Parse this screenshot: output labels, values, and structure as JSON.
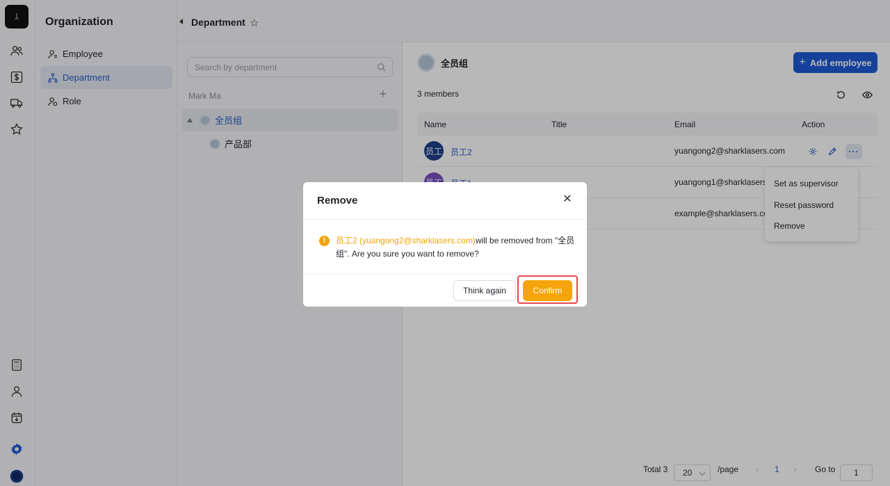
{
  "nav": {
    "title": "Organization",
    "items": [
      {
        "label": "Employee",
        "icon": "user-icon"
      },
      {
        "label": "Department",
        "icon": "org-chart-icon",
        "active": true
      },
      {
        "label": "Role",
        "icon": "role-icon"
      }
    ]
  },
  "header": {
    "title": "Department"
  },
  "tree": {
    "search_placeholder": "Search by department",
    "org_name": "Mark Ma",
    "nodes": [
      {
        "label": "全员组",
        "selected": true
      },
      {
        "label": "产品部"
      }
    ]
  },
  "main": {
    "group_name": "全员组",
    "add_button": "Add employee",
    "member_count": "3 members",
    "columns": [
      "Name",
      "Title",
      "Email",
      "Action"
    ],
    "rows": [
      {
        "avatar": "员工",
        "name": "员工2",
        "email": "yuangong2@sharklasers.com",
        "avatar_color": "#1e3f8a"
      },
      {
        "avatar": "员工",
        "name": "员工1",
        "email": "yuangong1@sharklasers.com",
        "avatar_color": "#7b4fc2"
      },
      {
        "avatar": "",
        "name": "",
        "email": "example@sharklasers.com",
        "avatar_color": "#7b4fc2"
      }
    ],
    "dropdown": [
      "Set as supervisor",
      "Reset password",
      "Remove"
    ]
  },
  "pagination": {
    "total": "Total 3",
    "page_size": "20",
    "per_page": "/page",
    "current": "1",
    "goto_label": "Go to",
    "goto_value": "1"
  },
  "modal": {
    "title": "Remove",
    "highlight": "员工2 (yuangong2@sharklasers.com)",
    "message": "will be removed from \"全员组\". Are you sure you want to remove?",
    "cancel": "Think again",
    "confirm": "Confirm"
  },
  "colors": {
    "accent": "#1f5ad6",
    "warning": "#f5a50b",
    "highlight_border": "#e8474a"
  }
}
